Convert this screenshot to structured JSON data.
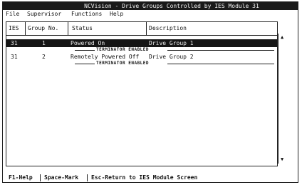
{
  "window": {
    "title": "NCVision - Drive Groups Controlled by IES Module 31"
  },
  "menu": {
    "file": "File",
    "supervisor": "Supervisor",
    "functions": "Functions",
    "help": "Help"
  },
  "table": {
    "headers": {
      "ies": "IES",
      "group": "Group No.",
      "status": "Status",
      "description": "Description"
    },
    "rows": [
      {
        "ies": "31",
        "group": "1",
        "status": "Powered On",
        "description": "Drive Group 1",
        "note": "TERMINATOR ENABLED"
      },
      {
        "ies": "31",
        "group": "2",
        "status": "Remotely Powered Off",
        "description": "Drive Group 2",
        "note": "TERMINATOR ENABLED"
      }
    ]
  },
  "scroll": {
    "up": "▲",
    "down": "▼"
  },
  "footer": {
    "f1": "F1-Help",
    "space": "Space-Mark",
    "esc": "Esc-Return to IES Module Screen"
  }
}
